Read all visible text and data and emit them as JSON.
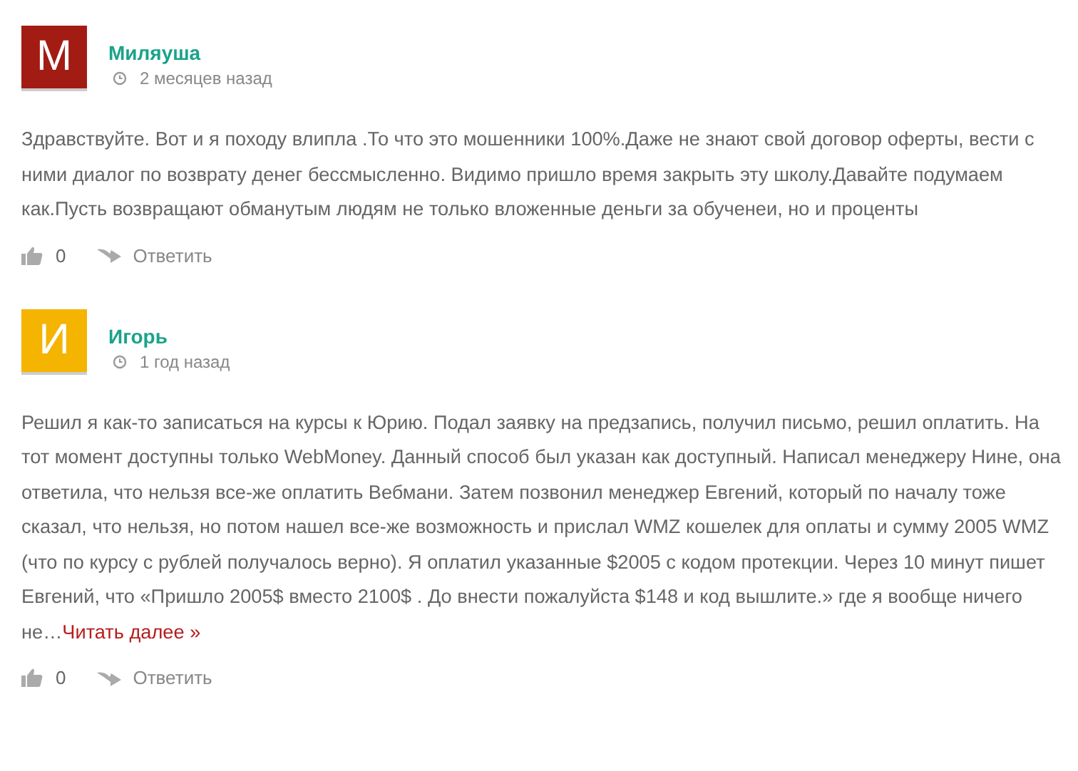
{
  "comments": [
    {
      "avatar_letter": "М",
      "color": "#a31c13",
      "author": "Миляуша",
      "time": "2 месяцев назад",
      "text": "Здравствуйте. Вот и я походу влипла .То что это мошенники 100%.Даже не знают свой договор оферты, вести с ними диалог по возврату денег бессмысленно. Видимо пришло время закрыть эту школу.Давайте подумаем как.Пусть возвращают обманутым людям не только вложенные деньги за обученеи, но и проценты",
      "likes": "0",
      "reply": "Ответить"
    },
    {
      "avatar_letter": "И",
      "color": "#f4b400",
      "author": "Игорь",
      "time": "1 год назад",
      "text": "Решил я как-то записаться на курсы к Юрию. Подал заявку на предзапись, получил письмо, решил оплатить. На тот момент доступны только WebMoney. Данный способ был указан как доступный. Написал менеджеру Нине, она ответила, что нельзя все-же оплатить Вебмани. Затем позвонил менеджер Евгений, который по началу тоже сказал, что нельзя, но потом нашел все-же возможность и прислал WMZ кошелек для оплаты и сумму 2005 WMZ (что по курсу с рублей получалось верно). Я оплатил указанные $2005 с кодом протекции. Через 10 минут пишет Евгений, что «Пришло 2005$ вместо 2100$ . До внести пожалуйста $148 и код вышлите.» где я вообще ничего не…",
      "read_more": "Читать далее »",
      "likes": "0",
      "reply": "Ответить"
    }
  ]
}
